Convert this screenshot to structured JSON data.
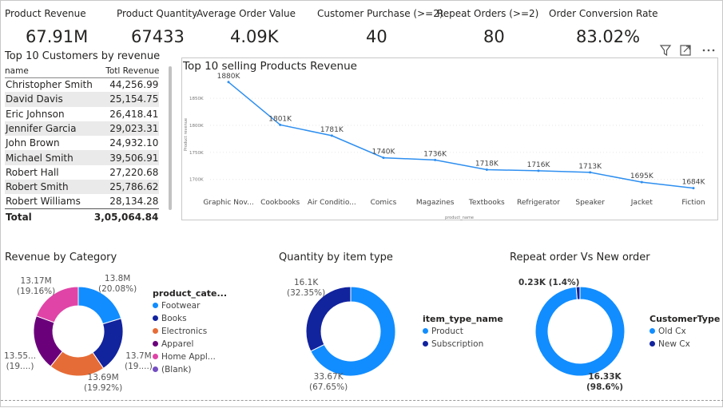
{
  "kpis": [
    {
      "label": "Product Revenue",
      "value": "67.91M"
    },
    {
      "label": "Product Quantity",
      "value": "67433"
    },
    {
      "label": "Average Order Value",
      "value": "4.09K"
    },
    {
      "label": "Customer Purchase (>=2)",
      "value": "40"
    },
    {
      "label": "Repeat Orders (>=2)",
      "value": "80"
    },
    {
      "label": "Order Conversion Rate",
      "value": "83.02%"
    }
  ],
  "customers": {
    "title": "Top 10 Customers by revenue",
    "col_name": "name",
    "col_revenue": "Totl Revenue",
    "rows": [
      {
        "name": "Christopher Smith",
        "revenue": "44,256.99"
      },
      {
        "name": "David Davis",
        "revenue": "25,154.75"
      },
      {
        "name": "Eric Johnson",
        "revenue": "26,418.41"
      },
      {
        "name": "Jennifer Garcia",
        "revenue": "29,023.31"
      },
      {
        "name": "John Brown",
        "revenue": "24,932.10"
      },
      {
        "name": "Michael Smith",
        "revenue": "39,506.91"
      },
      {
        "name": "Robert Hall",
        "revenue": "27,220.68"
      },
      {
        "name": "Robert Smith",
        "revenue": "25,786.62"
      },
      {
        "name": "Robert Williams",
        "revenue": "28,134.28"
      }
    ],
    "total_label": "Total",
    "total_value": "3,05,064.84"
  },
  "visual_icons": [
    "filter-icon",
    "focus-mode-icon",
    "more-options-icon"
  ],
  "chart_data": [
    {
      "type": "line",
      "title": "Top 10 selling Products Revenue",
      "xlabel": "product_name",
      "ylabel": "Product revenue",
      "categories": [
        "Graphic Nov...",
        "Cookbooks",
        "Air Conditio...",
        "Comics",
        "Magazines",
        "Textbooks",
        "Refrigerator",
        "Speaker",
        "Jacket",
        "Fiction"
      ],
      "values": [
        1880,
        1801,
        1781,
        1740,
        1736,
        1718,
        1716,
        1713,
        1695,
        1684
      ],
      "data_labels": [
        "1880K",
        "1801K",
        "1781K",
        "1740K",
        "1736K",
        "1718K",
        "1716K",
        "1713K",
        "1695K",
        "1684K"
      ],
      "yticks": [
        "1850K",
        "1800K",
        "1750K",
        "1700K"
      ],
      "ytick_values": [
        1850,
        1800,
        1750,
        1700
      ],
      "ylim": [
        1676,
        1893
      ],
      "color": "#2e8ff0"
    },
    {
      "type": "pie",
      "title": "Revenue by Category",
      "legend_title": "product_cate...",
      "categories": [
        "Footwear",
        "Books",
        "Electronics",
        "Apparel",
        "Home Appl...",
        "(Blank)"
      ],
      "values": [
        13.8,
        13.7,
        13.69,
        13.55,
        13.17,
        0
      ],
      "colors": [
        "#118dff",
        "#12239e",
        "#e66c37",
        "#6b007b",
        "#e044a7",
        "#744ec2"
      ],
      "labels": [
        {
          "value": "13.8M",
          "pct": "(20.08%)"
        },
        {
          "value": "13.7M",
          "pct": "(19....)"
        },
        {
          "value": "13.69M",
          "pct": "(19.92%)"
        },
        {
          "value": "13.55...",
          "pct": "(19....)"
        },
        {
          "value": "13.17M",
          "pct": "(19.16%)"
        }
      ]
    },
    {
      "type": "pie",
      "title": "Quantity by item type",
      "legend_title": "item_type_name",
      "categories": [
        "Product",
        "Subscription"
      ],
      "values": [
        33.67,
        16.1
      ],
      "colors": [
        "#118dff",
        "#12239e"
      ],
      "labels": [
        {
          "value": "33.67K",
          "pct": "(67.65%)"
        },
        {
          "value": "16.1K",
          "pct": "(32.35%)"
        }
      ]
    },
    {
      "type": "pie",
      "title": "Repeat order Vs New order",
      "legend_title": "CustomerType",
      "categories": [
        "Old Cx",
        "New Cx"
      ],
      "values": [
        16.33,
        0.23
      ],
      "colors": [
        "#118dff",
        "#12239e"
      ],
      "labels": [
        {
          "value": "16.33K",
          "pct": "(98.6%)"
        },
        {
          "value": "0.23K (1.4%)",
          "pct": ""
        }
      ]
    }
  ]
}
